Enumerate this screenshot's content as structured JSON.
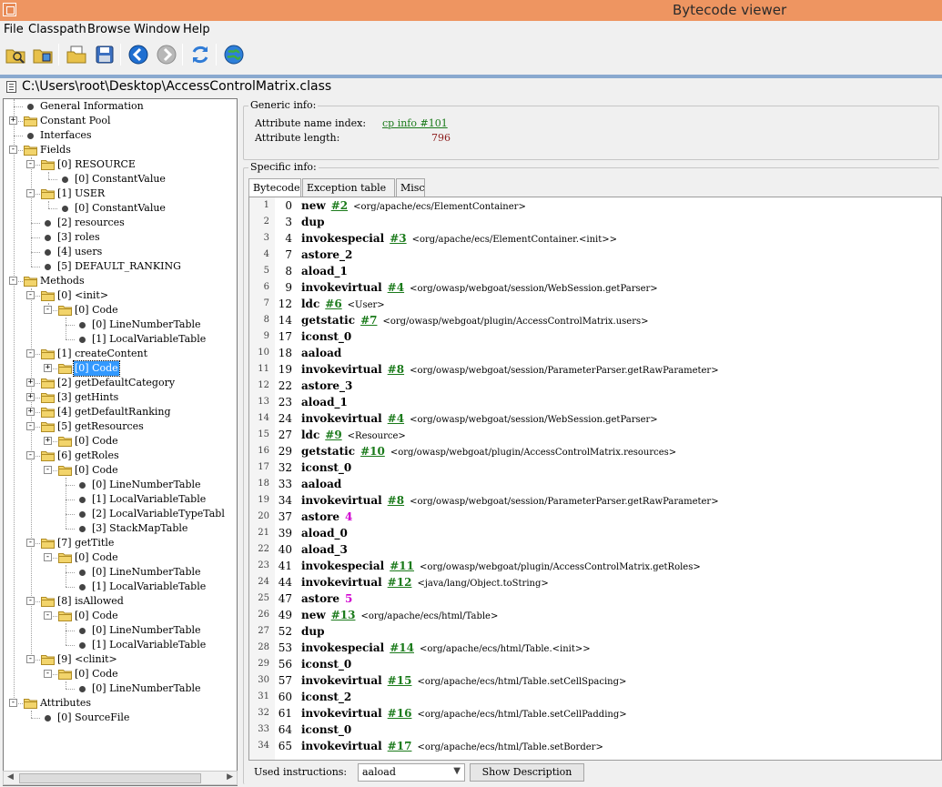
{
  "window": {
    "title": "Bytecode viewer"
  },
  "menu": [
    "File",
    "Classpath",
    "Browse",
    "Window",
    "Help"
  ],
  "toolbar": [
    "open-class-icon",
    "open-jar-icon",
    "open-folder-icon",
    "save-icon",
    "back-icon",
    "forward-icon",
    "refresh-icon",
    "web-icon"
  ],
  "path": "C:\\Users\\root\\Desktop\\AccessControlMatrix.class",
  "tree": [
    {
      "label": "General Information"
    },
    {
      "label": "Constant Pool"
    },
    {
      "label": "Interfaces"
    },
    {
      "label": "Fields"
    },
    {
      "label": "[0] RESOURCE"
    },
    {
      "label": "[0] ConstantValue"
    },
    {
      "label": "[1] USER"
    },
    {
      "label": "[0] ConstantValue"
    },
    {
      "label": "[2] resources"
    },
    {
      "label": "[3] roles"
    },
    {
      "label": "[4] users"
    },
    {
      "label": "[5] DEFAULT_RANKING"
    },
    {
      "label": "Methods"
    },
    {
      "label": "[0] <init>"
    },
    {
      "label": "[0] Code"
    },
    {
      "label": "[0] LineNumberTable"
    },
    {
      "label": "[1] LocalVariableTable"
    },
    {
      "label": "[1] createContent"
    },
    {
      "label": "[0] Code"
    },
    {
      "label": "[2] getDefaultCategory"
    },
    {
      "label": "[3] getHints"
    },
    {
      "label": "[4] getDefaultRanking"
    },
    {
      "label": "[5] getResources"
    },
    {
      "label": "[0] Code"
    },
    {
      "label": "[6] getRoles"
    },
    {
      "label": "[0] Code"
    },
    {
      "label": "[0] LineNumberTable"
    },
    {
      "label": "[1] LocalVariableTable"
    },
    {
      "label": "[2] LocalVariableTypeTabl"
    },
    {
      "label": "[3] StackMapTable"
    },
    {
      "label": "[7] getTitle"
    },
    {
      "label": "[0] Code"
    },
    {
      "label": "[0] LineNumberTable"
    },
    {
      "label": "[1] LocalVariableTable"
    },
    {
      "label": "[8] isAllowed"
    },
    {
      "label": "[0] Code"
    },
    {
      "label": "[0] LineNumberTable"
    },
    {
      "label": "[1] LocalVariableTable"
    },
    {
      "label": "[9] <clinit>"
    },
    {
      "label": "[0] Code"
    },
    {
      "label": "[0] LineNumberTable"
    },
    {
      "label": "Attributes"
    },
    {
      "label": "[0] SourceFile"
    }
  ],
  "generic": {
    "legend": "Generic info:",
    "name_index_label": "Attribute name index:",
    "name_index_value": "cp info #101",
    "length_label": "Attribute length:",
    "length_value": "796"
  },
  "specific": {
    "legend": "Specific info:",
    "tabs": [
      "Bytecode",
      "Exception table",
      "Misc"
    ]
  },
  "code": [
    {
      "ln": "1",
      "off": "0",
      "op": "new",
      "arg": "#2",
      "cmt": "<org/apache/ecs/ElementContainer>"
    },
    {
      "ln": "2",
      "off": "3",
      "op": "dup"
    },
    {
      "ln": "3",
      "off": "4",
      "op": "invokespecial",
      "arg": "#3",
      "cmt": "<org/apache/ecs/ElementContainer.<init>>"
    },
    {
      "ln": "4",
      "off": "7",
      "op": "astore_2"
    },
    {
      "ln": "5",
      "off": "8",
      "op": "aload_1"
    },
    {
      "ln": "6",
      "off": "9",
      "op": "invokevirtual",
      "arg": "#4",
      "cmt": "<org/owasp/webgoat/session/WebSession.getParser>"
    },
    {
      "ln": "7",
      "off": "12",
      "op": "ldc",
      "arg": "#6",
      "cmt": "<User>"
    },
    {
      "ln": "8",
      "off": "14",
      "op": "getstatic",
      "arg": "#7",
      "cmt": "<org/owasp/webgoat/plugin/AccessControlMatrix.users>"
    },
    {
      "ln": "9",
      "off": "17",
      "op": "iconst_0"
    },
    {
      "ln": "10",
      "off": "18",
      "op": "aaload"
    },
    {
      "ln": "11",
      "off": "19",
      "op": "invokevirtual",
      "arg": "#8",
      "cmt": "<org/owasp/webgoat/session/ParameterParser.getRawParameter>"
    },
    {
      "ln": "12",
      "off": "22",
      "op": "astore_3"
    },
    {
      "ln": "13",
      "off": "23",
      "op": "aload_1"
    },
    {
      "ln": "14",
      "off": "24",
      "op": "invokevirtual",
      "arg": "#4",
      "cmt": "<org/owasp/webgoat/session/WebSession.getParser>"
    },
    {
      "ln": "15",
      "off": "27",
      "op": "ldc",
      "arg": "#9",
      "cmt": "<Resource>"
    },
    {
      "ln": "16",
      "off": "29",
      "op": "getstatic",
      "arg": "#10",
      "cmt": "<org/owasp/webgoat/plugin/AccessControlMatrix.resources>"
    },
    {
      "ln": "17",
      "off": "32",
      "op": "iconst_0"
    },
    {
      "ln": "18",
      "off": "33",
      "op": "aaload"
    },
    {
      "ln": "19",
      "off": "34",
      "op": "invokevirtual",
      "arg": "#8",
      "cmt": "<org/owasp/webgoat/session/ParameterParser.getRawParameter>"
    },
    {
      "ln": "20",
      "off": "37",
      "op": "astore",
      "argp": "4"
    },
    {
      "ln": "21",
      "off": "39",
      "op": "aload_0"
    },
    {
      "ln": "22",
      "off": "40",
      "op": "aload_3"
    },
    {
      "ln": "23",
      "off": "41",
      "op": "invokespecial",
      "arg": "#11",
      "cmt": "<org/owasp/webgoat/plugin/AccessControlMatrix.getRoles>"
    },
    {
      "ln": "24",
      "off": "44",
      "op": "invokevirtual",
      "arg": "#12",
      "cmt": "<java/lang/Object.toString>"
    },
    {
      "ln": "25",
      "off": "47",
      "op": "astore",
      "argp": "5"
    },
    {
      "ln": "26",
      "off": "49",
      "op": "new",
      "arg": "#13",
      "cmt": "<org/apache/ecs/html/Table>"
    },
    {
      "ln": "27",
      "off": "52",
      "op": "dup"
    },
    {
      "ln": "28",
      "off": "53",
      "op": "invokespecial",
      "arg": "#14",
      "cmt": "<org/apache/ecs/html/Table.<init>>"
    },
    {
      "ln": "29",
      "off": "56",
      "op": "iconst_0"
    },
    {
      "ln": "30",
      "off": "57",
      "op": "invokevirtual",
      "arg": "#15",
      "cmt": "<org/apache/ecs/html/Table.setCellSpacing>"
    },
    {
      "ln": "31",
      "off": "60",
      "op": "iconst_2"
    },
    {
      "ln": "32",
      "off": "61",
      "op": "invokevirtual",
      "arg": "#16",
      "cmt": "<org/apache/ecs/html/Table.setCellPadding>"
    },
    {
      "ln": "33",
      "off": "64",
      "op": "iconst_0"
    },
    {
      "ln": "34",
      "off": "65",
      "op": "invokevirtual",
      "arg": "#17",
      "cmt": "<org/apache/ecs/html/Table.setBorder>"
    }
  ],
  "bottom": {
    "used_label": "Used instructions:",
    "used_value": "aaload",
    "show_button": "Show Description"
  }
}
